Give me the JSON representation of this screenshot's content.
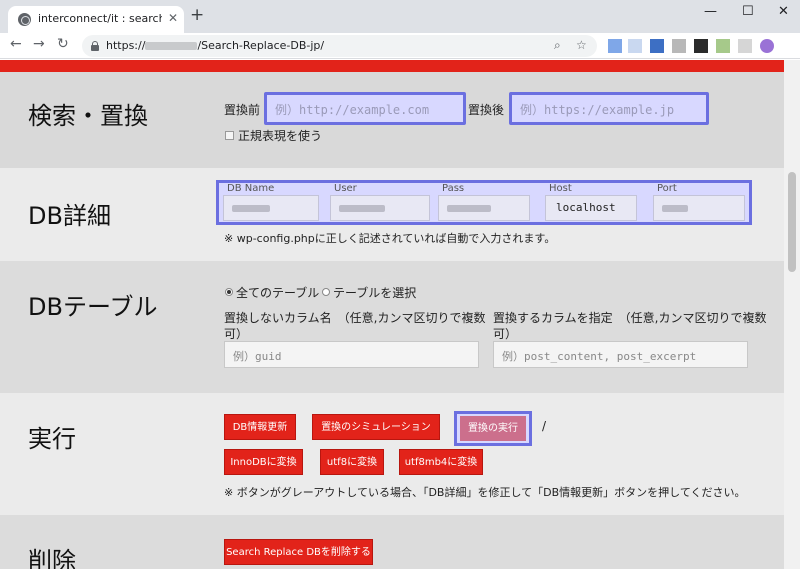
{
  "browser": {
    "tab_title": "interconnect/it : search replace d",
    "tab_close": "✕",
    "new_tab": "+",
    "url_prefix": "https://",
    "url_path": "/Search-Replace-DB-jp/",
    "window_controls": [
      "—",
      "☐",
      "✕"
    ]
  },
  "search": {
    "title": "検索・置換",
    "before_label": "置換前",
    "before_placeholder": "例）http://example.com",
    "after_label": "置換後",
    "after_placeholder": "例）https://example.jp",
    "regex_label": "正規表現を使う"
  },
  "db": {
    "title": "DB詳細",
    "fields": [
      {
        "label": "DB Name",
        "value": ""
      },
      {
        "label": "User",
        "value": ""
      },
      {
        "label": "Pass",
        "value": ""
      },
      {
        "label": "Host",
        "value": "localhost"
      },
      {
        "label": "Port",
        "value": ""
      }
    ],
    "note": "※ wp-config.phpに正しく記述されていれば自動で入力されます。"
  },
  "tables": {
    "title": "DBテーブル",
    "radio_all": "全てのテーブル",
    "radio_select": "テーブルを選択",
    "exclude_label_line1": "置換しないカラム名　（任意,カンマ区切りで複数",
    "exclude_label_line2": "可）",
    "exclude_placeholder": "例）guid",
    "include_label_line1": "置換するカラムを指定　（任意,カンマ区切りで複数",
    "include_label_line2": "可）",
    "include_placeholder": "例）post_content, post_excerpt"
  },
  "run": {
    "title": "実行",
    "update_db": "DB情報更新",
    "simulate": "置換のシミュレーション",
    "execute": "置換の実行",
    "slash": "/",
    "innodb": "InnoDBに変換",
    "utf8": "utf8に変換",
    "utf8mb4": "utf8mb4に変換",
    "note": "※ ボタンがグレーアウトしている場合、「DB詳細」を修正して「DB情報更新」ボタンを押してください。"
  },
  "delete": {
    "title": "削除",
    "button": "Search Replace DBを削除する"
  },
  "colors": {
    "accent_red": "#e2231a",
    "highlight_blue": "#6b6fe0"
  }
}
